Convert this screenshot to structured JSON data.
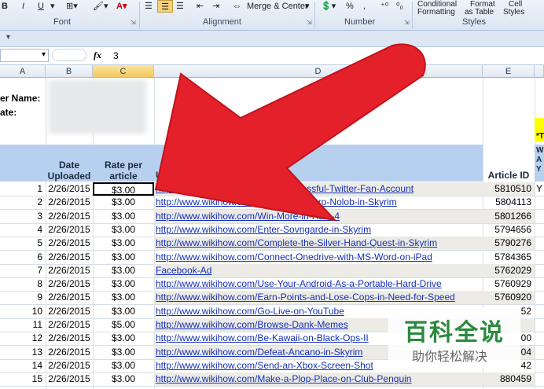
{
  "ribbon": {
    "buttons": {
      "bold": "B",
      "italic": "I",
      "underline": "U",
      "merge": "Merge & Center",
      "percent": "%",
      "comma": ",",
      "conditional_1": "Conditional",
      "conditional_2": "Formatting",
      "format_1": "Format",
      "format_2": "as Table",
      "cell_1": "Cell",
      "cell_2": "Styles"
    },
    "groups": {
      "font": "Font",
      "alignment": "Alignment",
      "number": "Number",
      "styles": "Styles"
    }
  },
  "formula_bar": {
    "fx": "fx",
    "value": "3"
  },
  "columns": [
    "A",
    "B",
    "C",
    "D",
    "E"
  ],
  "labels": {
    "name": "er Name:",
    "date": "ate:",
    "star": "*T",
    "col_f": [
      "W",
      "A",
      "Y"
    ],
    "col_f_row1": "Y"
  },
  "headers": {
    "date_1": "Date",
    "date_2": "Uploaded",
    "rate_1": "Rate per",
    "rate_2": "article",
    "url": "UR",
    "article_id": "Article ID"
  },
  "rows": [
    {
      "n": "1",
      "date": "2/26/2015",
      "rate": "$3.00",
      "url": "http://www.wikihow.com/Be-a-Successful-Twitter-Fan-Account",
      "id": "5810510"
    },
    {
      "n": "2",
      "date": "2/26/2015",
      "rate": "$3.00",
      "url": "http://www.wikihow.com/Kill-Balagog-Gro-Nolob-in-Skyrim",
      "id": "5804113"
    },
    {
      "n": "3",
      "date": "2/26/2015",
      "rate": "$3.00",
      "url": "http://www.wikihow.com/Win-More-in-Halo-4",
      "id": "5801266"
    },
    {
      "n": "4",
      "date": "2/26/2015",
      "rate": "$3.00",
      "url": "http://www.wikihow.com/Enter-Sovngarde-in-Skyrim",
      "id": "5794656"
    },
    {
      "n": "5",
      "date": "2/26/2015",
      "rate": "$3.00",
      "url": "http://www.wikihow.com/Complete-the-Silver-Hand-Quest-in-Skyrim",
      "id": "5790276"
    },
    {
      "n": "6",
      "date": "2/26/2015",
      "rate": "$3.00",
      "url": "http://www.wikihow.com/Connect-Onedrive-with-MS-Word-on-iPad",
      "id": "5784365"
    },
    {
      "n": "7",
      "date": "2/26/2015",
      "rate": "$3.00",
      "url": "Facebook-Ad",
      "id": "5762029"
    },
    {
      "n": "8",
      "date": "2/26/2015",
      "rate": "$3.00",
      "url": "http://www.wikihow.com/Use-Your-Android-As-a-Portable-Hard-Drive",
      "id": "5760929"
    },
    {
      "n": "9",
      "date": "2/26/2015",
      "rate": "$3.00",
      "url": "http://www.wikihow.com/Earn-Points-and-Lose-Cops-in-Need-for-Speed",
      "id": "5760920"
    },
    {
      "n": "10",
      "date": "2/26/2015",
      "rate": "$3.00",
      "url": "http://www.wikihow.com/Go-Live-on-YouTube",
      "id": "52"
    },
    {
      "n": "11",
      "date": "2/26/2015",
      "rate": "$5.00",
      "url": "http://www.wikihow.com/Browse-Dank-Memes",
      "id": ""
    },
    {
      "n": "12",
      "date": "2/26/2015",
      "rate": "$3.00",
      "url": "http://www.wikihow.com/Be-Kawaii-on-Black-Ops-II",
      "id": "00"
    },
    {
      "n": "13",
      "date": "2/26/2015",
      "rate": "$3.00",
      "url": "http://www.wikihow.com/Defeat-Ancano-in-Skyrim",
      "id": "04"
    },
    {
      "n": "14",
      "date": "2/26/2015",
      "rate": "$3.00",
      "url": "http://www.wikihow.com/Send-an-Xbox-Screen-Shot",
      "id": "42"
    },
    {
      "n": "15",
      "date": "2/26/2015",
      "rate": "$3.00",
      "url": "http://www.wikihow.com/Make-a-Plop-Place-on-Club-Penguin",
      "id": "880459"
    }
  ],
  "watermark": {
    "title": "百科全说",
    "subtitle": "助你轻松解决"
  },
  "colors": {
    "arrow": "#e4202a",
    "header_band": "#b7d0ef",
    "link": "#1530b8"
  }
}
